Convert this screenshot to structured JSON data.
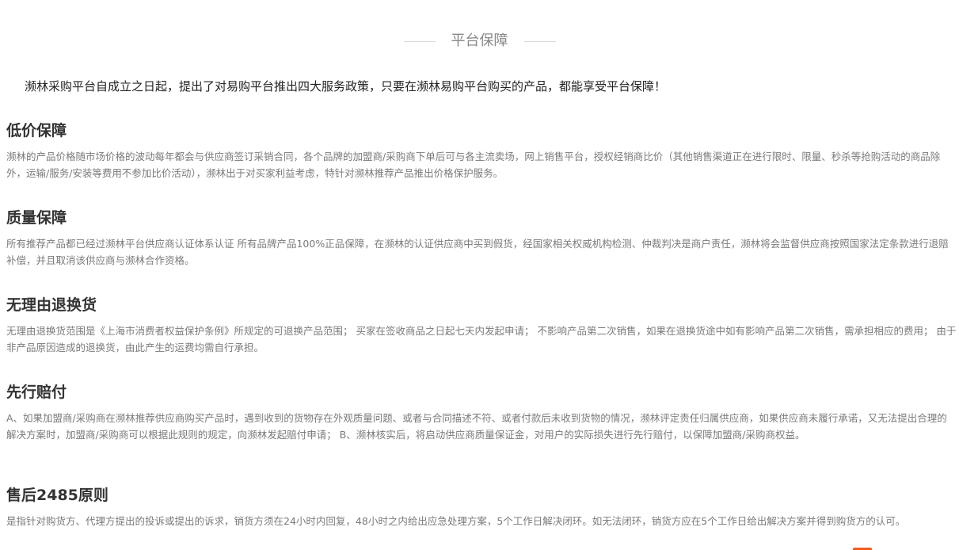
{
  "section": {
    "title": "平台保障"
  },
  "intro": "濒林采购平台自成立之日起，提出了对易购平台推出四大服务政策，只要在濒林易购平台购买的产品，都能享受平台保障！",
  "policies": [
    {
      "heading": "低价保障",
      "desc": "濒林的产品价格随市场价格的波动每年都会与供应商签订采销合同，各个品牌的加盟商/采购商下单后可与各主流卖场，网上销售平台，授权经销商比价（其他销售渠道正在进行限时、限量、秒杀等抢购活动的商品除外，运输/服务/安装等费用不参加比价活动），濒林出于对买家利益考虑，特针对濒林推荐产品推出价格保护服务。"
    },
    {
      "heading": "质量保障",
      "desc": "所有推荐产品都已经过濒林平台供应商认证体系认证 所有品牌产品100%正品保障，在濒林的认证供应商中买到假货，经国家相关权威机构检测、仲裁判决是商户责任，濒林将会监督供应商按照国家法定条款进行退赔补偿，并且取消该供应商与濒林合作资格。"
    },
    {
      "heading": "无理由退换货",
      "desc": "无理由退换货范围是《上海市消费者权益保护条例》所规定的可退换产品范围； 买家在签收商品之日起七天内发起申请； 不影响产品第二次销售，如果在退换货途中如有影响产品第二次销售，需承担相应的费用； 由于非产品原因造成的退换货，由此产生的运费均需自行承担。"
    },
    {
      "heading": "先行赔付",
      "desc": "A、如果加盟商/采购商在濒林推荐供应商购买产品时，遇到收到的货物存在外观质量问题、或者与合同描述不符、或者付款后未收到货物的情况，濒林评定责任归属供应商，如果供应商未履行承诺，又无法提出合理的解决方案时，加盟商/采购商可以根据此规则的规定，向濒林发起赔付申请； B、濒林核实后，将启动供应商质量保证金，对用户的实际损失进行先行赔付，以保障加盟商/采购商权益。"
    },
    {
      "heading": "售后2485原则",
      "desc": "是指针对购货方、代理方提出的投诉或提出的诉求，销货方须在24小时内回复，48小时之内给出应急处理方案，5个工作日解决闭环。如无法闭环，销货方应在5个工作日给出解决方案并得到购货方的认可。"
    }
  ],
  "colors": {
    "accent": "#f25c1f",
    "heading": "#333333",
    "body_text": "#7a7a7a",
    "header_line": "#d8d8d8"
  }
}
